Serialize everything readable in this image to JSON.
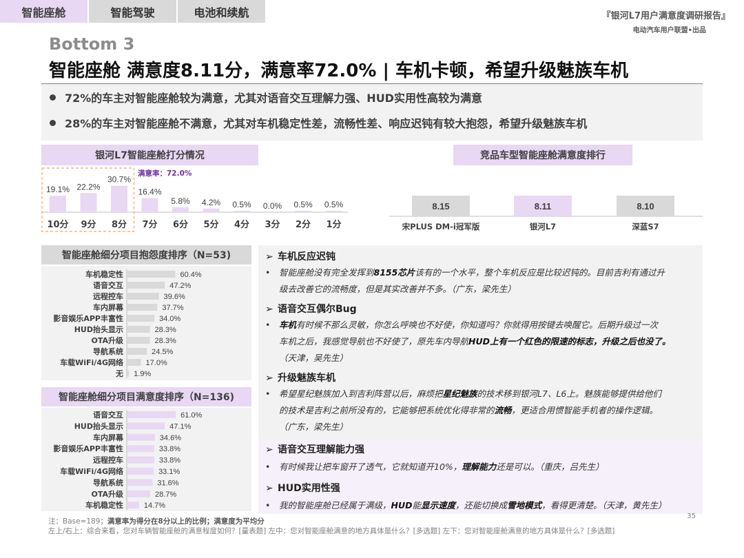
{
  "tabs": [
    "智能座舱",
    "智能驾驶",
    "电池和续航"
  ],
  "report": {
    "title": "『银河L7用户满意度调研报告』",
    "subtitle": "电动汽车用户联盟•出品"
  },
  "heading": {
    "tag": "Bottom 3",
    "headline": "智能座舱 满意度8.11分，满意率72.0% | 车机卡顿，希望升级魅族车机"
  },
  "summary": [
    "72%的车主对智能座舱较为满意，尤其对语音交互理解力强、HUD实用性高较为满意",
    "28%的车主对智能座舱不满意，尤其对车机稳定性差，流畅性差、响应迟钝有较大抱怨，希望升级魅族车机"
  ],
  "panels": {
    "rating": "银河L7智能座舱打分情况",
    "ranking": "竞品车型智能座舱满意度排行",
    "complaints": "智能座舱细分项目抱怨度排序（N=53)",
    "satisfaction": "智能座舱细分项目满意度排序（N=136)"
  },
  "chart_data": [
    {
      "type": "bar",
      "categories": [
        "10分",
        "9分",
        "8分",
        "7分",
        "6分",
        "5分",
        "4分",
        "3分",
        "2分",
        "1分"
      ],
      "values": [
        19.1,
        22.2,
        30.7,
        16.4,
        5.8,
        4.2,
        0.5,
        0.0,
        0.5,
        0.5
      ],
      "value_labels": [
        "19.1%",
        "22.2%",
        "30.7%",
        "16.4%",
        "5.8%",
        "4.2%",
        "0.5%",
        "0.0%",
        "0.5%",
        "0.5%"
      ],
      "annotation": "满意率：72.0%",
      "highlighted": [
        "10分",
        "9分",
        "8分"
      ],
      "color": "#e8d8f3",
      "annotation_color": "#7030a0"
    },
    {
      "type": "bar",
      "categories": [
        "宋PLUS DM-i冠军版",
        "银河L7",
        "深蓝S7"
      ],
      "values": [
        8.15,
        8.11,
        8.1
      ],
      "value_labels": [
        "8.15",
        "8.11",
        "8.10"
      ],
      "colors": [
        "#d9d9d9",
        "#e8d8f3",
        "#d9d9d9"
      ]
    },
    {
      "type": "bar",
      "orientation": "horizontal",
      "categories": [
        "车机稳定性",
        "语音交互",
        "远程控车",
        "车内屏幕",
        "影音娱乐APP丰富性",
        "HUD抬头显示",
        "OTA升级",
        "导航系统",
        "车载WiFi/4G网络",
        "无"
      ],
      "values": [
        60.4,
        47.2,
        39.6,
        37.7,
        34.0,
        28.3,
        28.3,
        24.5,
        17.0,
        1.9
      ],
      "value_labels": [
        "60.4%",
        "47.2%",
        "39.6%",
        "37.7%",
        "34.0%",
        "28.3%",
        "28.3%",
        "24.5%",
        "17.0%",
        "1.9%"
      ],
      "color": "#d9d9d9"
    },
    {
      "type": "bar",
      "orientation": "horizontal",
      "categories": [
        "语音交互",
        "HUD抬头显示",
        "车内屏幕",
        "影音娱乐APP丰富性",
        "远程控车",
        "车载WiFi/4G网络",
        "导航系统",
        "OTA升级",
        "车机稳定性"
      ],
      "values": [
        61.0,
        47.1,
        34.6,
        33.8,
        33.8,
        33.1,
        31.6,
        28.7,
        14.7
      ],
      "value_labels": [
        "61.0%",
        "47.1%",
        "34.6%",
        "33.8%",
        "33.8%",
        "33.1%",
        "31.6%",
        "28.7%",
        "14.7%"
      ],
      "color": "#e8d8f3"
    }
  ],
  "quotes": {
    "arrow": "➢",
    "bullet": "•",
    "t1": "车机反应迟钝",
    "q1a_pre": "智能座舱没有完全发挥到",
    "q1a_b": "8155芯片",
    "q1a_post": "该有的一个水平，整个车机反应是比较迟钝的。目前吉利有通过升",
    "q1b": "级去改善它的流畅度，但是其实改善并不多。（广东，梁先生）",
    "t2": "语音交互偶尔Bug",
    "q2a_b": "车机",
    "q2a_post": "有时候不那么灵敏，你怎么呼唤也不好使，你知道吗？你就得用按键去唤醒它。后期升级过一次",
    "q2b_pre": "车机之后，我感觉导航也不好使了，原先车内导航",
    "q2b_b": "HUD",
    "q2b_post": "上有一个红色的限速的标志，升级之后也没了。",
    "q2c": "（天津，吴先生）",
    "t3": "升级魅族车机",
    "q3a_pre": "希望星纪魅族加入到吉利阵营以后，麻烦把",
    "q3a_b": "星纪魅族",
    "q3a_post": "的技术移到银河L7、L6上。魅族能够提供给他们",
    "q3b_pre": "的技术是吉利之前所没有的，它能够把系统优化得非常的",
    "q3b_b": "流畅",
    "q3b_post": "，更适合用惯智能手机者的操作逻辑。",
    "q3c": "（广东，梁先生）",
    "t4": "语音交互理解能力强",
    "q4_pre": "有时候我让把车窗开了透气，它就知道开10%，",
    "q4_b": "理解能力",
    "q4_post": "还是可以。（重庆，吕先生）",
    "t5": "HUD实用性强",
    "q5_pre": "我的智能座舱已经属于满级，",
    "q5_b1": "HUD",
    "q5_mid1": "能",
    "q5_b2": "显示速度",
    "q5_mid2": "，还能切换成",
    "q5_b3": "雪地模式",
    "q5_post": "，看得更清楚。（天津，黄先生）"
  },
  "notes": {
    "n1_pre": "注：Base=189；",
    "n1_b": "满意率为得分在8分以上的比例；满意度为平均分",
    "n2": "左上/右上：综合来看，您对车辆智能座舱的满意程度如何？[量表题]      左中：您对智能座舱满意的地方具体是什么？[多选题]      左下：您对智能座舱满意的地方具体是什么？[多选题]"
  },
  "page_number": "35"
}
